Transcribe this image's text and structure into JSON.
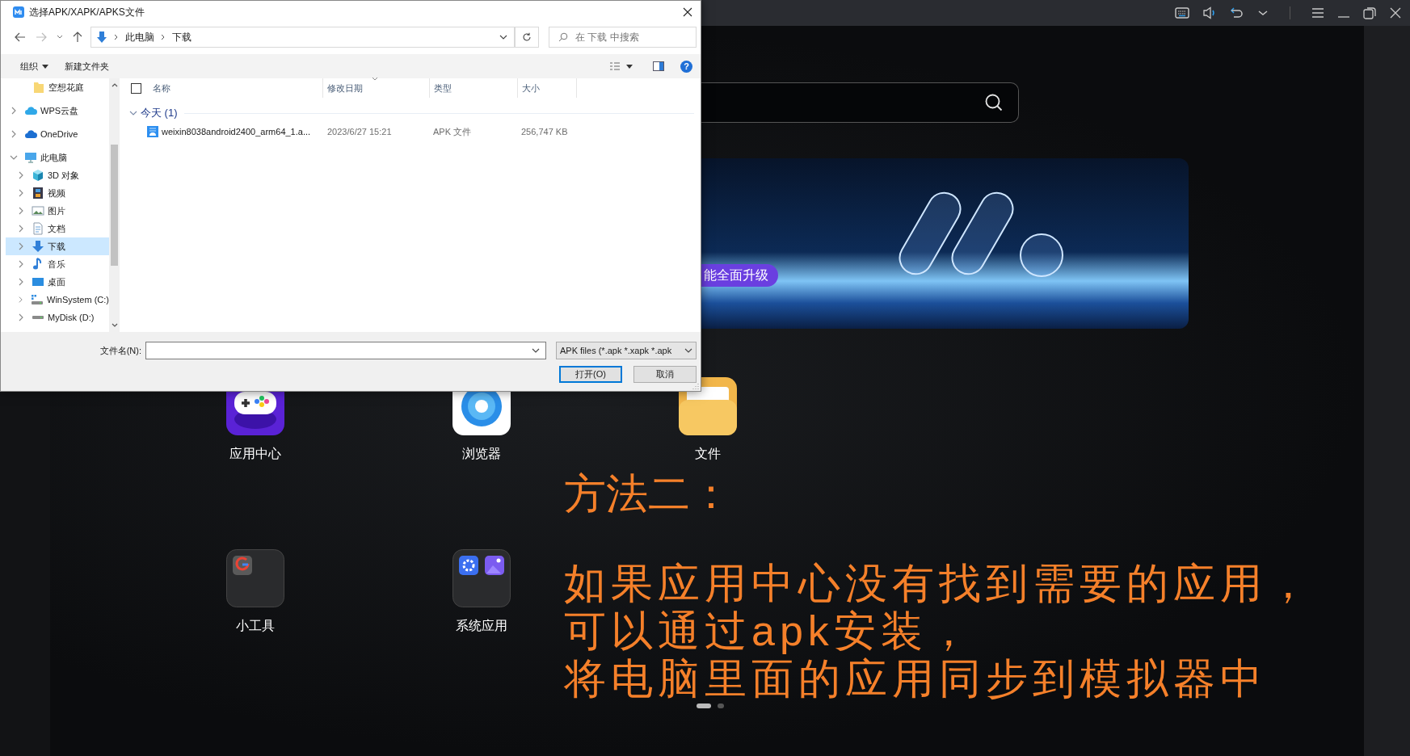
{
  "emulator": {
    "banner": {
      "badge": "能全面升级"
    },
    "apps": [
      {
        "label": "应用中心",
        "kind": "game"
      },
      {
        "label": "浏览器",
        "kind": "browser"
      },
      {
        "label": "文件",
        "kind": "files"
      },
      {
        "label": "小工具",
        "kind": "folder-tools"
      },
      {
        "label": "系统应用",
        "kind": "folder-system"
      }
    ],
    "pages": [
      {
        "selected": true
      },
      {
        "selected": false
      }
    ],
    "caption": {
      "heading": "方法二：",
      "lines": [
        "如果应用中心没有找到需要的应用，",
        "可以通过apk安装，",
        "将电脑里面的应用同步到模拟器中"
      ]
    }
  },
  "dialog": {
    "title": "选择APK/XAPK/APKS文件",
    "breadcrumb": [
      "此电脑",
      "下载"
    ],
    "search": {
      "placeholder": "在 下载 中搜索"
    },
    "toolbar": [
      "组织",
      "新建文件夹"
    ],
    "help_label": "?",
    "sidebar": {
      "items": [
        {
          "label": "空想花庭",
          "kind": "folder",
          "selected": false
        },
        {
          "label": "WPS云盘",
          "kind": "cloud-wps",
          "expanded": false,
          "selected": false
        },
        {
          "label": "OneDrive",
          "kind": "cloud",
          "expanded": false,
          "selected": false
        },
        {
          "label": "此电脑",
          "kind": "pc",
          "expanded": true,
          "selected": false,
          "children": [
            {
              "label": "3D 对象",
              "kind": "cube",
              "expanded": false,
              "selected": false
            },
            {
              "label": "视频",
              "kind": "video",
              "expanded": false,
              "selected": false
            },
            {
              "label": "图片",
              "kind": "pictures",
              "expanded": false,
              "selected": false
            },
            {
              "label": "文档",
              "kind": "documents",
              "expanded": false,
              "selected": false
            },
            {
              "label": "下载",
              "kind": "downloads",
              "expanded": false,
              "selected": true
            },
            {
              "label": "音乐",
              "kind": "music",
              "expanded": false,
              "selected": false
            },
            {
              "label": "桌面",
              "kind": "desktop",
              "expanded": false,
              "selected": false
            },
            {
              "label": "WinSystem (C:)",
              "kind": "drive-system",
              "expanded": false,
              "selected": false
            },
            {
              "label": "MyDisk (D:)",
              "kind": "drive",
              "expanded": false,
              "selected": false
            }
          ]
        }
      ]
    },
    "table": {
      "select_all": {
        "checked": false
      },
      "columns": [
        {
          "label": "名称",
          "sorted": false
        },
        {
          "label": "修改日期",
          "sorted": true
        },
        {
          "label": "类型",
          "sorted": false
        },
        {
          "label": "大小",
          "sorted": false
        }
      ],
      "groups": [
        {
          "label": "今天 (1)",
          "expanded": true,
          "rows": [
            {
              "name": "weixin8038android2400_arm64_1.a...",
              "date": "2023/6/27 15:21",
              "type": "APK 文件",
              "size": "256,747 KB"
            }
          ]
        }
      ]
    },
    "footer": {
      "filename_label": "文件名(N):",
      "filter": "APK files (*.apk *.xapk *.apk",
      "buttons": [
        {
          "label": "打开(O)",
          "default": true
        },
        {
          "label": "取消",
          "default": false
        }
      ]
    }
  }
}
